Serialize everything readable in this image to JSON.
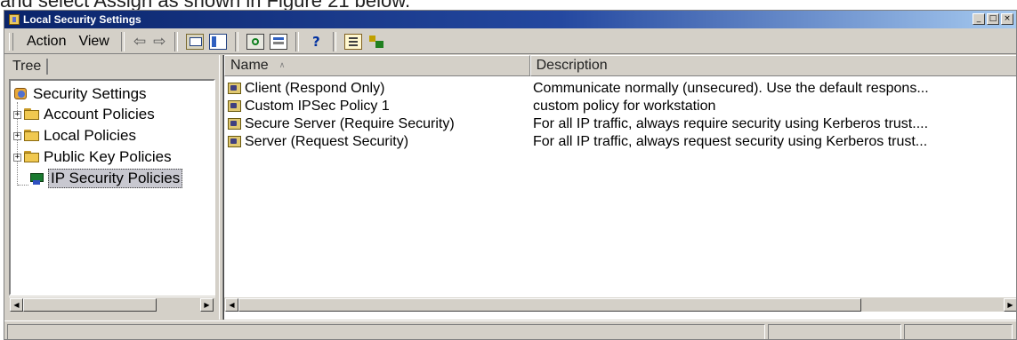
{
  "page": {
    "caption": "and select Assign as shown in Figure 21 below."
  },
  "window": {
    "title": "Local Security Settings",
    "title_buttons": [
      "minimize-icon",
      "maximize-icon",
      "close-icon"
    ]
  },
  "toolbar": {
    "menu": [
      "Action",
      "View"
    ],
    "back_glyph": "⇦",
    "forward_glyph": "⇨",
    "tools": [
      {
        "icon": "up-folder-icon"
      },
      {
        "icon": "show-hide-tree-icon"
      },
      {
        "icon": "refresh-icon"
      },
      {
        "icon": "export-list-icon"
      },
      {
        "icon": "help-icon",
        "glyph": "?"
      },
      {
        "icon": "properties-icon"
      },
      {
        "icon": "assign-policy-icon"
      }
    ]
  },
  "tree": {
    "header": "Tree",
    "items": [
      {
        "label": "Security Settings",
        "icon": "security-settings-icon",
        "expander": ""
      },
      {
        "label": "Account Policies",
        "icon": "folder-icon",
        "expander": "+"
      },
      {
        "label": "Local Policies",
        "icon": "folder-icon",
        "expander": "+"
      },
      {
        "label": "Public Key Policies",
        "icon": "folder-icon",
        "expander": "+"
      },
      {
        "label": "IP Security Policies",
        "icon": "ip-security-icon",
        "expander": "",
        "selected": true
      }
    ]
  },
  "list": {
    "columns": [
      "Name",
      "Description"
    ],
    "sort_glyph": "∧",
    "rows": [
      {
        "name": "Client (Respond Only)",
        "description": "Communicate normally (unsecured). Use the default respons..."
      },
      {
        "name": "Custom IPSec Policy 1",
        "description": "custom policy for workstation"
      },
      {
        "name": "Secure Server (Require Security)",
        "description": "For all IP traffic, always require security using Kerberos trust...."
      },
      {
        "name": "Server (Request Security)",
        "description": "For all IP traffic, always request security using Kerberos trust..."
      }
    ]
  },
  "colors": {
    "titlebar_start": "#0a246a",
    "titlebar_end": "#a6caf0",
    "face": "#d4d0c8"
  }
}
